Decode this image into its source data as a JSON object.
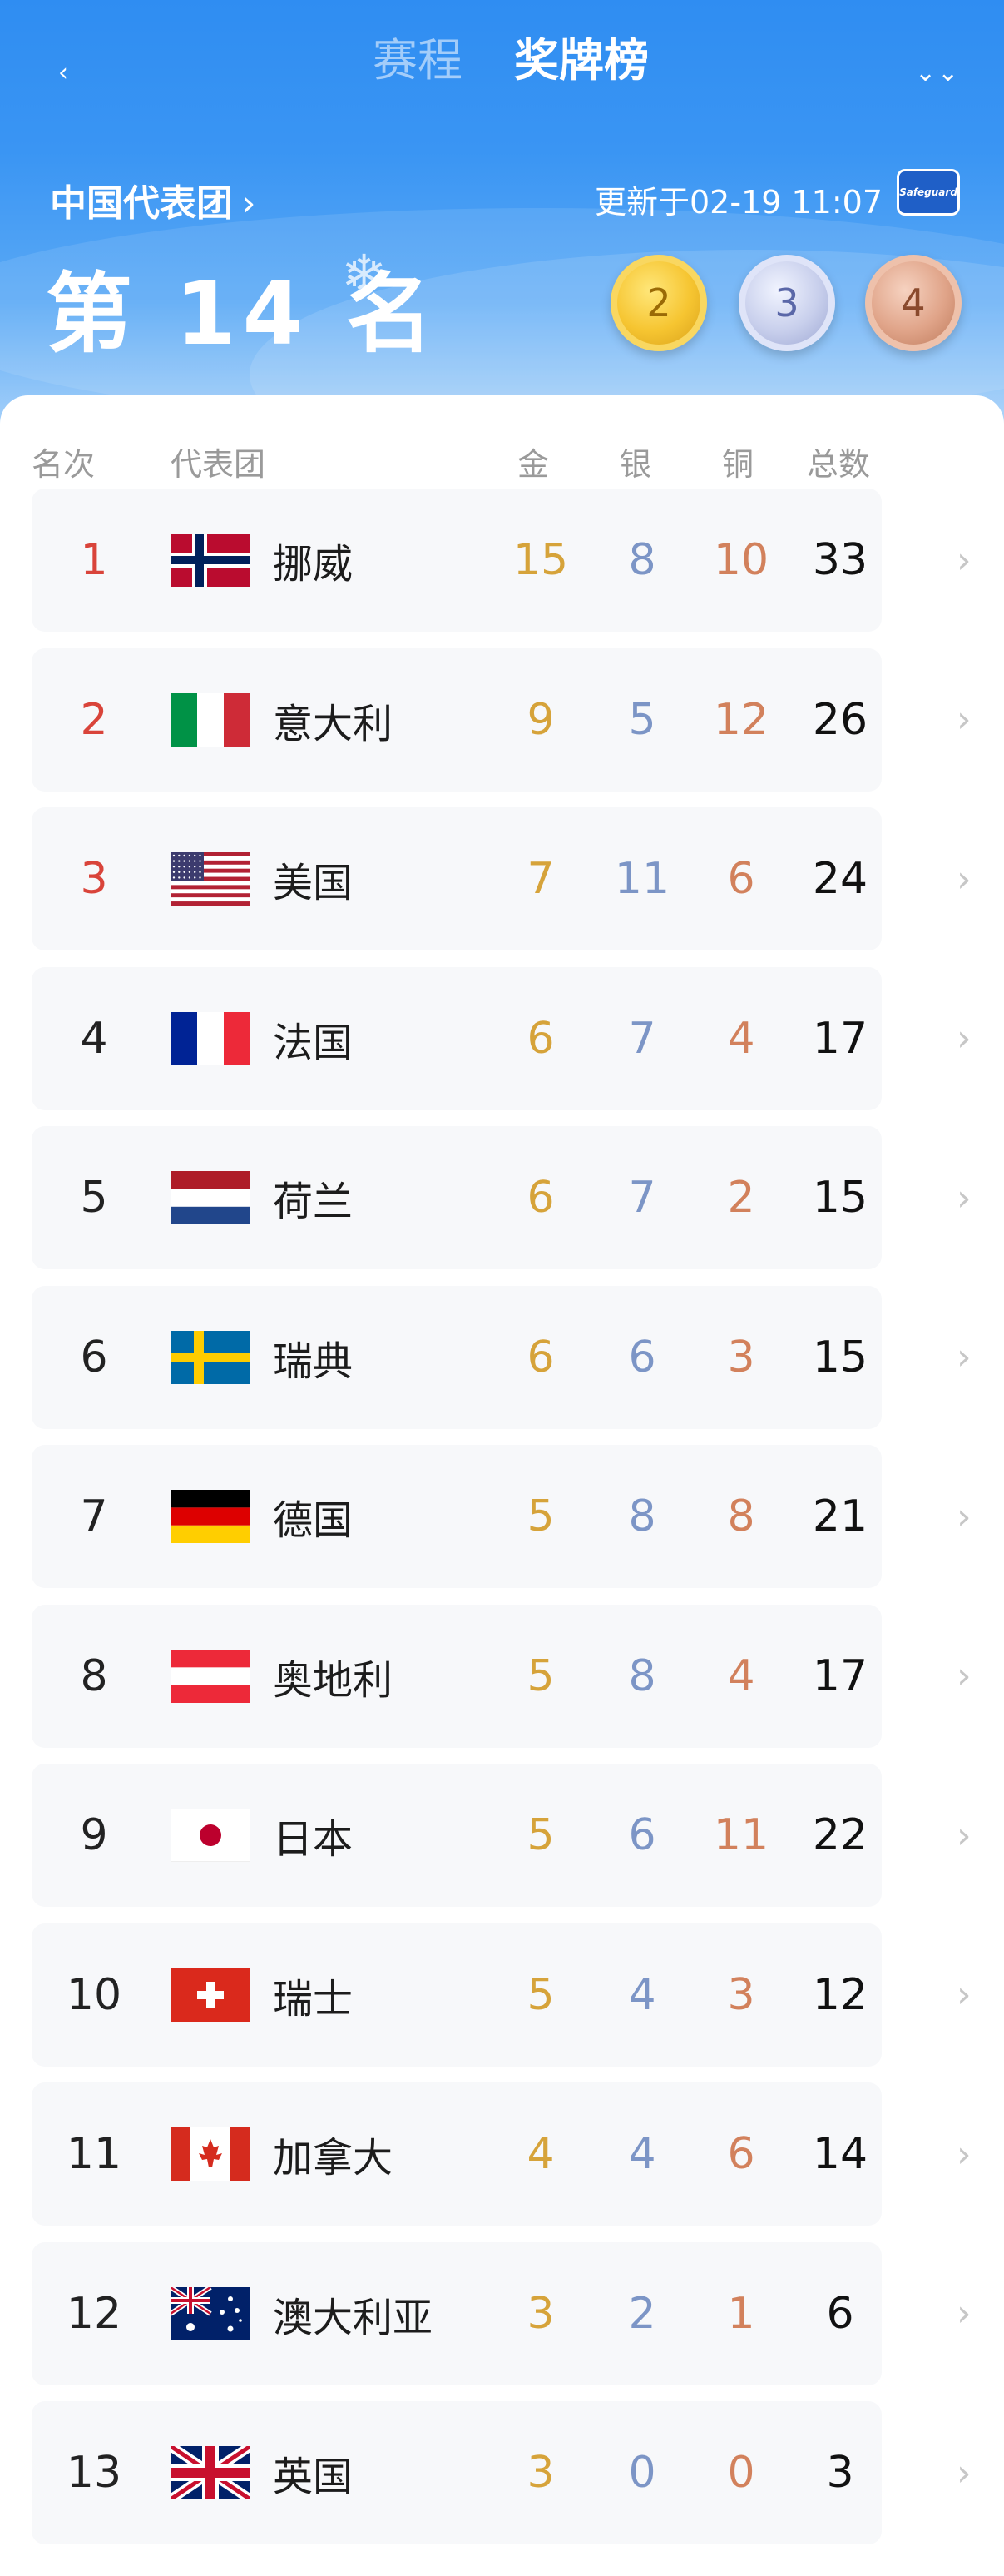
{
  "nav": {
    "back_label": "‹",
    "tabs": [
      {
        "label": "赛程"
      },
      {
        "label": "奖牌榜"
      }
    ],
    "more_label": "⌄⌄"
  },
  "summary": {
    "delegation": "中国代表团",
    "chevron": "›",
    "updated": "更新于02-19 11:07",
    "sponsor": "Safeguard",
    "rank_text": "第 14 名",
    "snow_icon": "❄",
    "gold": "2",
    "silver": "3",
    "bronze": "4"
  },
  "columns": {
    "rank": "名次",
    "team": "代表团",
    "gold": "金",
    "silver": "银",
    "bronze": "铜",
    "total": "总数"
  },
  "rows": [
    {
      "rank": "1",
      "team": "挪威",
      "flag": "norway",
      "gold": "15",
      "silver": "8",
      "bronze": "10",
      "total": "33"
    },
    {
      "rank": "2",
      "team": "意大利",
      "flag": "italy",
      "gold": "9",
      "silver": "5",
      "bronze": "12",
      "total": "26"
    },
    {
      "rank": "3",
      "team": "美国",
      "flag": "usa",
      "gold": "7",
      "silver": "11",
      "bronze": "6",
      "total": "24"
    },
    {
      "rank": "4",
      "team": "法国",
      "flag": "france",
      "gold": "6",
      "silver": "7",
      "bronze": "4",
      "total": "17"
    },
    {
      "rank": "5",
      "team": "荷兰",
      "flag": "netherlands",
      "gold": "6",
      "silver": "7",
      "bronze": "2",
      "total": "15"
    },
    {
      "rank": "6",
      "team": "瑞典",
      "flag": "sweden",
      "gold": "6",
      "silver": "6",
      "bronze": "3",
      "total": "15"
    },
    {
      "rank": "7",
      "team": "德国",
      "flag": "germany",
      "gold": "5",
      "silver": "8",
      "bronze": "8",
      "total": "21"
    },
    {
      "rank": "8",
      "team": "奥地利",
      "flag": "austria",
      "gold": "5",
      "silver": "8",
      "bronze": "4",
      "total": "17"
    },
    {
      "rank": "9",
      "team": "日本",
      "flag": "japan",
      "gold": "5",
      "silver": "6",
      "bronze": "11",
      "total": "22"
    },
    {
      "rank": "10",
      "team": "瑞士",
      "flag": "switzerland",
      "gold": "5",
      "silver": "4",
      "bronze": "3",
      "total": "12"
    },
    {
      "rank": "11",
      "team": "加拿大",
      "flag": "canada",
      "gold": "4",
      "silver": "4",
      "bronze": "6",
      "total": "14"
    },
    {
      "rank": "12",
      "team": "澳大利亚",
      "flag": "australia",
      "gold": "3",
      "silver": "2",
      "bronze": "1",
      "total": "6"
    },
    {
      "rank": "13",
      "team": "英国",
      "flag": "uk",
      "gold": "3",
      "silver": "0",
      "bronze": "0",
      "total": "3"
    }
  ],
  "row_chevron": "›"
}
